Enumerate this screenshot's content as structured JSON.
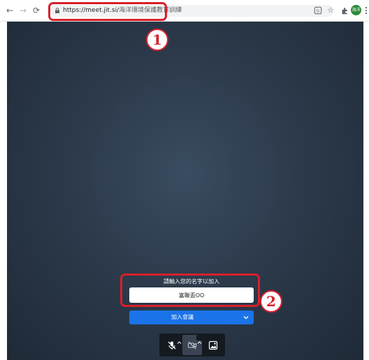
{
  "browser": {
    "url_host": "https://meet.jit.si/",
    "url_path": "海洋環境保護教育訓練",
    "avatar_text": "海洋"
  },
  "annotations": [
    {
      "label": "1"
    },
    {
      "label": "2"
    }
  ],
  "prejoin": {
    "prompt": "請輸入您的名字以加入",
    "name_value": "富聯盃OO",
    "join_label": "加入會議"
  },
  "colors": {
    "accent": "#1a73e8",
    "annotation": "#d8202a",
    "stage": "#2c3a4b"
  },
  "icons": [
    "back-icon",
    "forward-icon",
    "reload-icon",
    "lock-icon",
    "translate-icon",
    "star-icon",
    "extensions-icon",
    "menu-icon",
    "chevron-down-icon",
    "mic-off-icon",
    "camera-off-icon",
    "background-icon"
  ]
}
